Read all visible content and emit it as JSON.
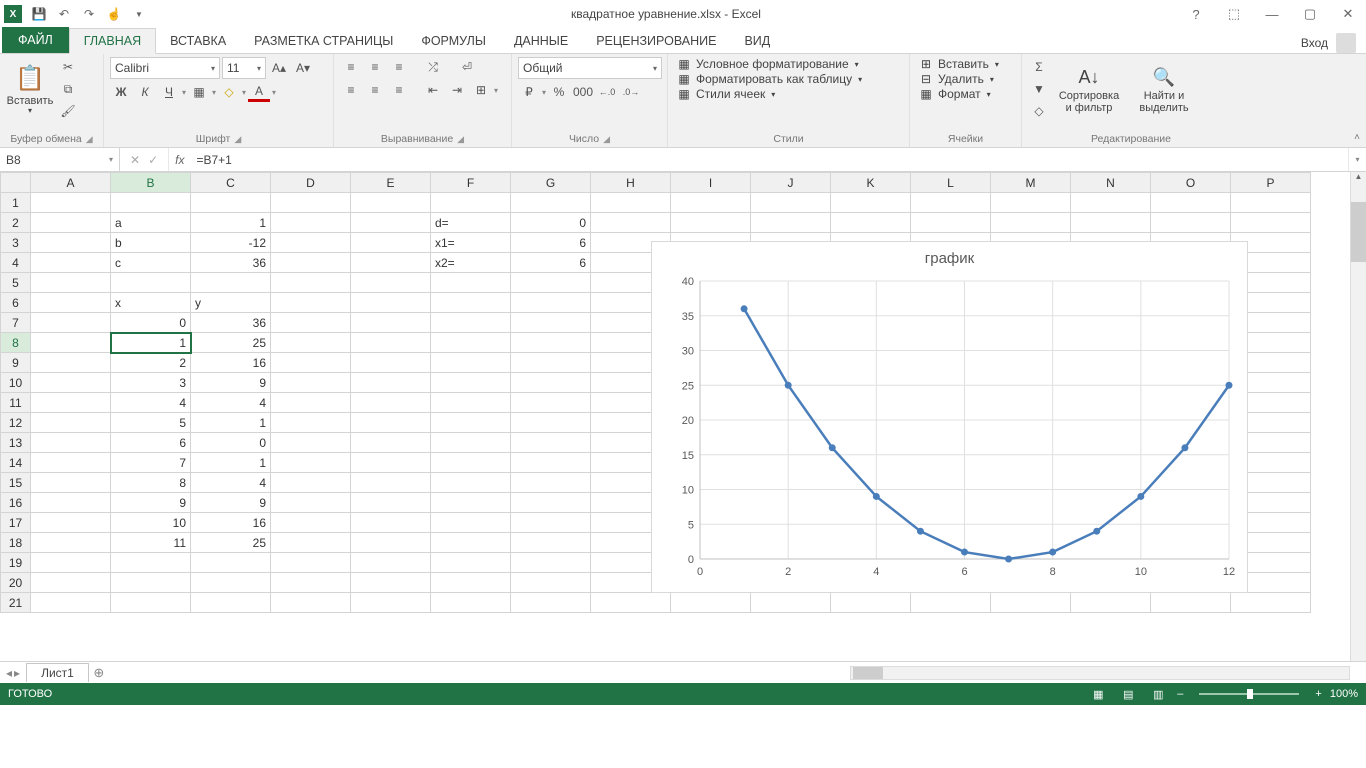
{
  "title": "квадратное уравнение.xlsx - Excel",
  "login_label": "Вход",
  "tabs": {
    "file": "ФАЙЛ",
    "items": [
      "ГЛАВНАЯ",
      "ВСТАВКА",
      "РАЗМЕТКА СТРАНИЦЫ",
      "ФОРМУЛЫ",
      "ДАННЫЕ",
      "РЕЦЕНЗИРОВАНИЕ",
      "ВИД"
    ],
    "active_index": 0
  },
  "ribbon_groups": {
    "clipboard": {
      "label": "Буфер обмена",
      "paste": "Вставить"
    },
    "font": {
      "label": "Шрифт",
      "name": "Calibri",
      "size": "11"
    },
    "alignment": {
      "label": "Выравнивание"
    },
    "number": {
      "label": "Число",
      "format": "Общий"
    },
    "styles": {
      "label": "Стили",
      "b1": "Условное форматирование",
      "b2": "Форматировать как таблицу",
      "b3": "Стили ячеек"
    },
    "cells": {
      "label": "Ячейки",
      "b1": "Вставить",
      "b2": "Удалить",
      "b3": "Формат"
    },
    "editing": {
      "label": "Редактирование",
      "sort": "Сортировка\nи фильтр",
      "find": "Найти и\nвыделить"
    }
  },
  "namebox": "B8",
  "formula": "=B7+1",
  "columns": [
    "A",
    "B",
    "C",
    "D",
    "E",
    "F",
    "G",
    "H",
    "I",
    "J",
    "K",
    "L",
    "M",
    "N",
    "O",
    "P"
  ],
  "rows_count": 21,
  "active_col": "B",
  "active_row": 8,
  "cells": {
    "B2": {
      "v": "a",
      "a": "l"
    },
    "C2": {
      "v": "1"
    },
    "B3": {
      "v": "b",
      "a": "l"
    },
    "C3": {
      "v": "-12"
    },
    "B4": {
      "v": "c",
      "a": "l"
    },
    "C4": {
      "v": "36"
    },
    "F2": {
      "v": "d=",
      "a": "l"
    },
    "G2": {
      "v": "0"
    },
    "F3": {
      "v": "x1=",
      "a": "l"
    },
    "G3": {
      "v": "6"
    },
    "F4": {
      "v": "x2=",
      "a": "l"
    },
    "G4": {
      "v": "6"
    },
    "B6": {
      "v": "x",
      "a": "l"
    },
    "C6": {
      "v": "y",
      "a": "l"
    },
    "B7": {
      "v": "0"
    },
    "C7": {
      "v": "36"
    },
    "B8": {
      "v": "1"
    },
    "C8": {
      "v": "25"
    },
    "B9": {
      "v": "2"
    },
    "C9": {
      "v": "16"
    },
    "B10": {
      "v": "3"
    },
    "C10": {
      "v": "9"
    },
    "B11": {
      "v": "4"
    },
    "C11": {
      "v": "4"
    },
    "B12": {
      "v": "5"
    },
    "C12": {
      "v": "1"
    },
    "B13": {
      "v": "6"
    },
    "C13": {
      "v": "0"
    },
    "B14": {
      "v": "7"
    },
    "C14": {
      "v": "1"
    },
    "B15": {
      "v": "8"
    },
    "C15": {
      "v": "4"
    },
    "B16": {
      "v": "9"
    },
    "C16": {
      "v": "9"
    },
    "B17": {
      "v": "10"
    },
    "C17": {
      "v": "16"
    },
    "B18": {
      "v": "11"
    },
    "C18": {
      "v": "25"
    }
  },
  "chart_data": {
    "type": "line",
    "title": "график",
    "x": [
      1,
      2,
      3,
      4,
      5,
      6,
      7,
      8,
      9,
      10,
      11,
      12
    ],
    "values": [
      36,
      25,
      16,
      9,
      4,
      1,
      0,
      1,
      4,
      9,
      16,
      25
    ],
    "x_ticks": [
      0,
      2,
      4,
      6,
      8,
      10,
      12
    ],
    "y_ticks": [
      0,
      5,
      10,
      15,
      20,
      25,
      30,
      35,
      40
    ],
    "xlim": [
      0,
      12
    ],
    "ylim": [
      0,
      40
    ]
  },
  "sheet_tab": "Лист1",
  "status": "ГОТОВО",
  "zoom": "100%"
}
